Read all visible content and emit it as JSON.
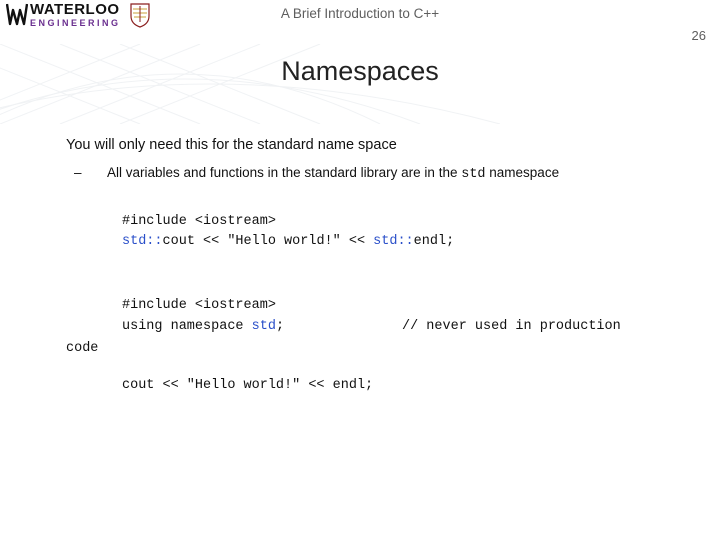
{
  "header": {
    "logo_word": "WATERLOO",
    "logo_sub": "ENGINEERING",
    "doc_title": "A Brief Introduction to C++",
    "page_number": "26"
  },
  "heading": "Namespaces",
  "intro": "You will only need this for the standard name space",
  "bullet": {
    "prefix": "–",
    "text_before": "All variables and functions in the standard library are in the ",
    "kw": "std",
    "text_after": " namespace"
  },
  "code1": {
    "l1a": "#include <iostream>",
    "l2_kw1": "std::",
    "l2_mid": "cout << \"Hello world!\" << ",
    "l2_kw2": "std::",
    "l2_end": "endl;"
  },
  "code2": {
    "l1": "#include <iostream>",
    "l2_a": "using namespace ",
    "l2_kw": "std",
    "l2_b": ";",
    "comment": "// never used in production",
    "note": "code",
    "l4": "cout << \"Hello world!\" << endl;"
  }
}
